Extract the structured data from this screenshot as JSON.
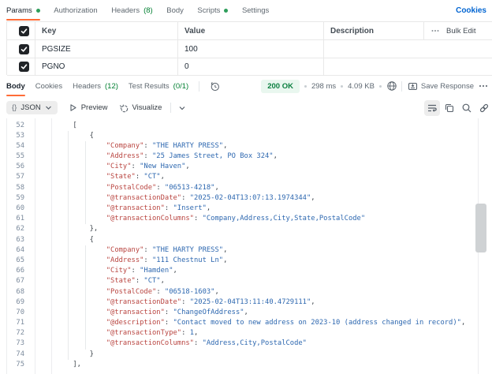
{
  "request_tabs": [
    {
      "label": "Params",
      "dot": true,
      "active": true
    },
    {
      "label": "Authorization"
    },
    {
      "label": "Headers",
      "count": "(8)"
    },
    {
      "label": "Body"
    },
    {
      "label": "Scripts",
      "dot": true
    },
    {
      "label": "Settings"
    }
  ],
  "cookies_link": "Cookies",
  "params_table": {
    "headers": {
      "key": "Key",
      "value": "Value",
      "description": "Description",
      "bulk_edit": "Bulk Edit"
    },
    "rows": [
      {
        "key": "PGSIZE",
        "value": "100",
        "description": "",
        "checked": true
      },
      {
        "key": "PGNO",
        "value": "0",
        "description": "",
        "checked": true
      }
    ]
  },
  "response_tabs": [
    {
      "label": "Body",
      "active": true
    },
    {
      "label": "Cookies"
    },
    {
      "label": "Headers",
      "count": "(12)"
    },
    {
      "label": "Test Results",
      "count": "(0/1)"
    }
  ],
  "response_meta": {
    "status": "200 OK",
    "time": "298 ms",
    "size": "4.09 KB",
    "save": "Save Response"
  },
  "view_bar": {
    "braces": "{}",
    "format": "JSON",
    "preview": "Preview",
    "visualize": "Visualize"
  },
  "code": {
    "lines": [
      {
        "n": "52",
        "i": 8,
        "t": [
          [
            "p",
            "["
          ]
        ]
      },
      {
        "n": "53",
        "i": 12,
        "t": [
          [
            "p",
            "{"
          ]
        ]
      },
      {
        "n": "54",
        "i": 16,
        "t": [
          [
            "k",
            "\"Company\""
          ],
          [
            "p",
            ": "
          ],
          [
            "s",
            "\"THE HARTY PRESS\""
          ],
          [
            "p",
            ","
          ]
        ]
      },
      {
        "n": "55",
        "i": 16,
        "t": [
          [
            "k",
            "\"Address\""
          ],
          [
            "p",
            ": "
          ],
          [
            "s",
            "\"25 James Street, PO Box 324\""
          ],
          [
            "p",
            ","
          ]
        ]
      },
      {
        "n": "56",
        "i": 16,
        "t": [
          [
            "k",
            "\"City\""
          ],
          [
            "p",
            ": "
          ],
          [
            "s",
            "\"New Haven\""
          ],
          [
            "p",
            ","
          ]
        ]
      },
      {
        "n": "57",
        "i": 16,
        "t": [
          [
            "k",
            "\"State\""
          ],
          [
            "p",
            ": "
          ],
          [
            "s",
            "\"CT\""
          ],
          [
            "p",
            ","
          ]
        ]
      },
      {
        "n": "58",
        "i": 16,
        "t": [
          [
            "k",
            "\"PostalCode\""
          ],
          [
            "p",
            ": "
          ],
          [
            "s",
            "\"06513-4218\""
          ],
          [
            "p",
            ","
          ]
        ]
      },
      {
        "n": "59",
        "i": 16,
        "t": [
          [
            "k",
            "\"@transactionDate\""
          ],
          [
            "p",
            ": "
          ],
          [
            "s",
            "\"2025-02-04T13:07:13.1974344\""
          ],
          [
            "p",
            ","
          ]
        ]
      },
      {
        "n": "60",
        "i": 16,
        "t": [
          [
            "k",
            "\"@transaction\""
          ],
          [
            "p",
            ": "
          ],
          [
            "s",
            "\"Insert\""
          ],
          [
            "p",
            ","
          ]
        ]
      },
      {
        "n": "61",
        "i": 16,
        "t": [
          [
            "k",
            "\"@transactionColumns\""
          ],
          [
            "p",
            ": "
          ],
          [
            "s",
            "\"Company,Address,City,State,PostalCode\""
          ]
        ]
      },
      {
        "n": "62",
        "i": 12,
        "t": [
          [
            "p",
            "},"
          ]
        ]
      },
      {
        "n": "63",
        "i": 12,
        "t": [
          [
            "p",
            "{"
          ]
        ]
      },
      {
        "n": "64",
        "i": 16,
        "t": [
          [
            "k",
            "\"Company\""
          ],
          [
            "p",
            ": "
          ],
          [
            "s",
            "\"THE HARTY PRESS\""
          ],
          [
            "p",
            ","
          ]
        ]
      },
      {
        "n": "65",
        "i": 16,
        "t": [
          [
            "k",
            "\"Address\""
          ],
          [
            "p",
            ": "
          ],
          [
            "s",
            "\"111 Chestnut Ln\""
          ],
          [
            "p",
            ","
          ]
        ]
      },
      {
        "n": "66",
        "i": 16,
        "t": [
          [
            "k",
            "\"City\""
          ],
          [
            "p",
            ": "
          ],
          [
            "s",
            "\"Hamden\""
          ],
          [
            "p",
            ","
          ]
        ]
      },
      {
        "n": "67",
        "i": 16,
        "t": [
          [
            "k",
            "\"State\""
          ],
          [
            "p",
            ": "
          ],
          [
            "s",
            "\"CT\""
          ],
          [
            "p",
            ","
          ]
        ]
      },
      {
        "n": "68",
        "i": 16,
        "t": [
          [
            "k",
            "\"PostalCode\""
          ],
          [
            "p",
            ": "
          ],
          [
            "s",
            "\"06518-1603\""
          ],
          [
            "p",
            ","
          ]
        ]
      },
      {
        "n": "69",
        "i": 16,
        "t": [
          [
            "k",
            "\"@transactionDate\""
          ],
          [
            "p",
            ": "
          ],
          [
            "s",
            "\"2025-02-04T13:11:40.4729111\""
          ],
          [
            "p",
            ","
          ]
        ]
      },
      {
        "n": "70",
        "i": 16,
        "t": [
          [
            "k",
            "\"@transaction\""
          ],
          [
            "p",
            ": "
          ],
          [
            "s",
            "\"ChangeOfAddress\""
          ],
          [
            "p",
            ","
          ]
        ]
      },
      {
        "n": "71",
        "i": 16,
        "t": [
          [
            "k",
            "\"@description\""
          ],
          [
            "p",
            ": "
          ],
          [
            "s",
            "\"Contact moved to new address on 2023-10 (address changed in record)\""
          ],
          [
            "p",
            ","
          ]
        ]
      },
      {
        "n": "72",
        "i": 16,
        "t": [
          [
            "k",
            "\"@transactionType\""
          ],
          [
            "p",
            ": "
          ],
          [
            "n",
            "1"
          ],
          [
            "p",
            ","
          ]
        ]
      },
      {
        "n": "73",
        "i": 16,
        "t": [
          [
            "k",
            "\"@transactionColumns\""
          ],
          [
            "p",
            ": "
          ],
          [
            "s",
            "\"Address,City,PostalCode\""
          ]
        ]
      },
      {
        "n": "74",
        "i": 12,
        "t": [
          [
            "p",
            "}"
          ]
        ]
      },
      {
        "n": "75",
        "i": 8,
        "t": [
          [
            "p",
            "],"
          ]
        ]
      }
    ]
  }
}
